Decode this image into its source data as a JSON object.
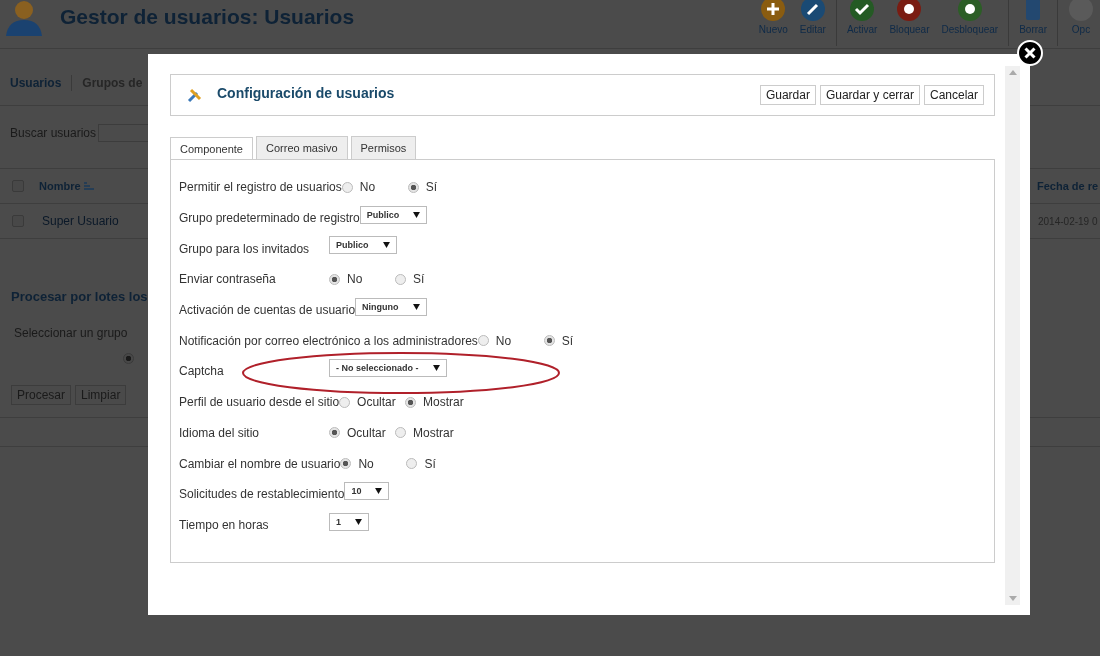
{
  "header": {
    "title": "Gestor de usuarios: Usuarios"
  },
  "toolbar": [
    {
      "label": "Nuevo",
      "kind": "new"
    },
    {
      "label": "Editar",
      "kind": "edit"
    },
    {
      "label": "Activar",
      "kind": "activate"
    },
    {
      "label": "Bloquear",
      "kind": "block"
    },
    {
      "label": "Desbloquear",
      "kind": "unblock"
    },
    {
      "label": "Borrar",
      "kind": "delete"
    },
    {
      "label": "Opc",
      "kind": "options"
    }
  ],
  "submenu": [
    {
      "label": "Usuarios",
      "selected": true
    },
    {
      "label": "Grupos de",
      "selected": false
    }
  ],
  "search": {
    "label": "Buscar usuarios"
  },
  "table": {
    "header_checked": false,
    "columns": [
      "Nombre",
      "Fecha de re"
    ],
    "rows": [
      {
        "checked": false,
        "cells": [
          "Super Usuario",
          "2014-02-19 0"
        ]
      }
    ]
  },
  "batch": {
    "title": "Procesar por lotes los",
    "group_label": "Seleccionar un grupo",
    "radio_selected": true,
    "buttons": [
      "Procesar",
      "Limpiar"
    ]
  },
  "modal": {
    "title": "Configuración de usuarios",
    "buttons": [
      "Guardar",
      "Guardar y cerrar",
      "Cancelar"
    ],
    "tabs": [
      {
        "label": "Componente",
        "selected": true
      },
      {
        "label": "Correo masivo",
        "selected": false
      },
      {
        "label": "Permisos",
        "selected": false
      }
    ],
    "fields": [
      {
        "kind": "radio",
        "label": "Permitir el registro de usuarios",
        "options": [
          {
            "label": "No",
            "selected": false
          },
          {
            "label": "Sí",
            "selected": true
          }
        ]
      },
      {
        "kind": "select",
        "label": "Grupo predeterminado de registro",
        "value": "Publico"
      },
      {
        "kind": "select",
        "label": "Grupo para los invitados",
        "value": "Publico"
      },
      {
        "kind": "radio",
        "label": "Enviar contraseña",
        "options": [
          {
            "label": "No",
            "selected": true
          },
          {
            "label": "Sí",
            "selected": false
          }
        ]
      },
      {
        "kind": "select",
        "label": "Activación de cuentas de usuario",
        "value": "Ninguno"
      },
      {
        "kind": "radio",
        "label": "Notificación por correo electrónico a los administradores",
        "options": [
          {
            "label": "No",
            "selected": false
          },
          {
            "label": "Sí",
            "selected": true
          }
        ]
      },
      {
        "kind": "select",
        "label": "Captcha",
        "value": "- No seleccionado -"
      },
      {
        "kind": "radio",
        "label": "Perfil de usuario desde el sitio",
        "options": [
          {
            "label": "Ocultar",
            "selected": false
          },
          {
            "label": "Mostrar",
            "selected": true
          }
        ]
      },
      {
        "kind": "radio",
        "label": "Idioma del sitio",
        "options": [
          {
            "label": "Ocultar",
            "selected": true
          },
          {
            "label": "Mostrar",
            "selected": false
          }
        ]
      },
      {
        "kind": "radio",
        "label": "Cambiar el nombre de usuario",
        "options": [
          {
            "label": "No",
            "selected": true
          },
          {
            "label": "Sí",
            "selected": false
          }
        ]
      },
      {
        "kind": "select",
        "label": "Solicitudes de restablecimiento",
        "value": "10"
      },
      {
        "kind": "select",
        "label": "Tiempo en horas",
        "value": "1"
      }
    ]
  }
}
